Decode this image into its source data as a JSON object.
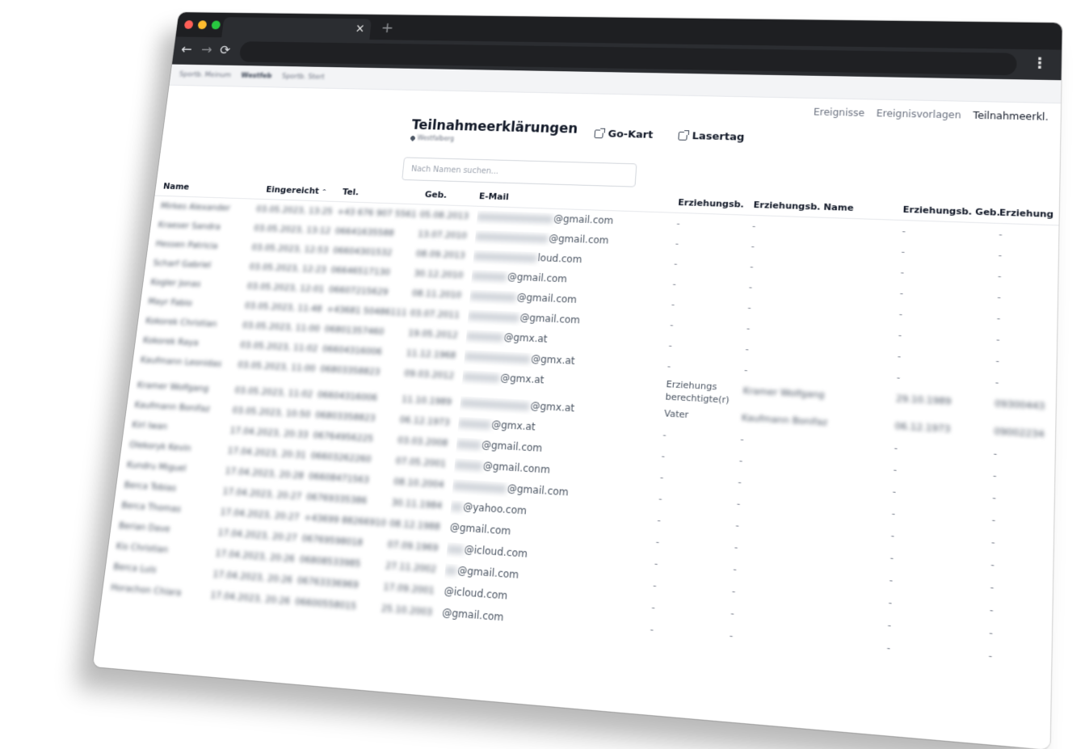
{
  "browser": {
    "tab_close": "×",
    "new_tab": "+",
    "back": "←",
    "forward": "→",
    "reload": "⟳",
    "menu": "⋮",
    "bookmarks": [
      "Sportb. Meinum",
      "Westfeb",
      "Sportb. Stert"
    ]
  },
  "nav": {
    "items": [
      "Ereignisse",
      "Ereignisvorlagen",
      "Teilnahmeerkl."
    ],
    "active": "Teilnahmeerkl."
  },
  "header": {
    "title": "Teilnahmeerklärungen",
    "location": "Westfalberg"
  },
  "events": [
    "Go-Kart",
    "Lasertag"
  ],
  "search": {
    "placeholder": "Nach Namen suchen..."
  },
  "table": {
    "headers": {
      "name": "Name",
      "submitted": "Eingereicht",
      "sort_indicator": "^",
      "phone": "Tel.",
      "birth": "Geb.",
      "email": "E-Mail",
      "guardian": "Erziehungsb.",
      "guardian_name": "Erziehungsb. Name",
      "guardian_birth": "Erziehungsb. Geb.",
      "guardian_tel": "Erziehung"
    },
    "rows": [
      {
        "name": "Mirkes Alexander",
        "submitted": "03.05.2023, 13:25",
        "phone": "+43 676 907 5561",
        "birth": "05.08.2013",
        "email_domain": "@gmail.com",
        "guardian": "-",
        "guardian_name": "-",
        "guardian_birth": "-",
        "guardian_tel": "-"
      },
      {
        "name": "Kraeser Sandra",
        "submitted": "03.05.2023, 13:12",
        "phone": "06641635588",
        "birth": "13.07.2010",
        "email_domain": "@gmail.com",
        "guardian": "-",
        "guardian_name": "-",
        "guardian_birth": "-",
        "guardian_tel": "-"
      },
      {
        "name": "Hessen Patricia",
        "submitted": "03.05.2023, 12:53",
        "phone": "06604301532",
        "birth": "08.09.2013",
        "email_domain": "loud.com",
        "guardian": "-",
        "guardian_name": "-",
        "guardian_birth": "-",
        "guardian_tel": "-"
      },
      {
        "name": "Scharf Gabriel",
        "submitted": "03.05.2023, 12:23",
        "phone": "06646517130",
        "birth": "30.12.2010",
        "email_domain": "@gmail.com",
        "guardian": "-",
        "guardian_name": "-",
        "guardian_birth": "-",
        "guardian_tel": "-"
      },
      {
        "name": "Kogler Jonas",
        "submitted": "03.05.2023, 12:01",
        "phone": "06607215629",
        "birth": "08.11.2010",
        "email_domain": "@gmail.com",
        "guardian": "-",
        "guardian_name": "-",
        "guardian_birth": "-",
        "guardian_tel": "-"
      },
      {
        "name": "Mayr Fabio",
        "submitted": "03.05.2023, 11:48",
        "phone": "+43681 50486111",
        "birth": "03.07.2011",
        "email_domain": "@gmail.com",
        "guardian": "-",
        "guardian_name": "-",
        "guardian_birth": "-",
        "guardian_tel": "-"
      },
      {
        "name": "Kokorek Christian",
        "submitted": "03.05.2023, 11:00",
        "phone": "06801357460",
        "birth": "19.05.2012",
        "email_domain": "@gmx.at",
        "guardian": "-",
        "guardian_name": "-",
        "guardian_birth": "-",
        "guardian_tel": "-"
      },
      {
        "name": "Kokorek Raya",
        "submitted": "03.05.2023, 11:02",
        "phone": "06604316006",
        "birth": "11.12.1968",
        "email_domain": "@gmx.at",
        "guardian": "-",
        "guardian_name": "-",
        "guardian_birth": "-",
        "guardian_tel": "-"
      },
      {
        "name": "Kaufmann Leonidas",
        "submitted": "03.05.2023, 11:00",
        "phone": "06803358823",
        "birth": "09.03.2012",
        "email_domain": "@gmx.at",
        "guardian": "Erziehungs berechtigte(r)",
        "guardian_name": "Kramer Wolfgang",
        "guardian_birth": "29.10.1989",
        "guardian_tel": "09300443"
      },
      {
        "name": "Kramer Wolfgang",
        "submitted": "03.05.2023, 11:02",
        "phone": "06604316006",
        "birth": "11.10.1989",
        "email_domain": "@gmx.at",
        "guardian": "Vater",
        "guardian_name": "Kaufmann Bonifaz",
        "guardian_birth": "06.12.1973",
        "guardian_tel": "09002234"
      },
      {
        "name": "Kaufmann Bonifaz",
        "submitted": "03.05.2023, 10:50",
        "phone": "06803358823",
        "birth": "06.12.1973",
        "email_domain": "@gmx.at",
        "guardian": "-",
        "guardian_name": "-",
        "guardian_birth": "-",
        "guardian_tel": "-"
      },
      {
        "name": "Kirl Iwan",
        "submitted": "17.04.2023, 20:33",
        "phone": "06764956225",
        "birth": "03.03.2008",
        "email_domain": "@gmail.com",
        "guardian": "-",
        "guardian_name": "-",
        "guardian_birth": "-",
        "guardian_tel": "-"
      },
      {
        "name": "Olekoryk Kevin",
        "submitted": "17.04.2023, 20:31",
        "phone": "06603262260",
        "birth": "07.05.2001",
        "email_domain": "@gmail.conm",
        "guardian": "-",
        "guardian_name": "-",
        "guardian_birth": "-",
        "guardian_tel": "-"
      },
      {
        "name": "Kundru Miguel",
        "submitted": "17.04.2023, 20:28",
        "phone": "06608471563",
        "birth": "08.10.2004",
        "email_domain": "@gmail.com",
        "guardian": "-",
        "guardian_name": "-",
        "guardian_birth": "-",
        "guardian_tel": "-"
      },
      {
        "name": "Berca Tobias",
        "submitted": "17.04.2023, 20:27",
        "phone": "06769335386",
        "birth": "30.11.1984",
        "email_domain": "@yahoo.com",
        "guardian": "-",
        "guardian_name": "-",
        "guardian_birth": "-",
        "guardian_tel": "-"
      },
      {
        "name": "Berca Thomas",
        "submitted": "17.04.2023, 20:27",
        "phone": "+43699 88266910",
        "birth": "08.12.1988",
        "email_domain": "@gmail.com",
        "guardian": "-",
        "guardian_name": "-",
        "guardian_birth": "-",
        "guardian_tel": "-"
      },
      {
        "name": "Berian Dave",
        "submitted": "17.04.2023, 20:27",
        "phone": "06769598018",
        "birth": "07.09.1969",
        "email_domain": "@icloud.com",
        "guardian": "-",
        "guardian_name": "-",
        "guardian_birth": "-",
        "guardian_tel": "-"
      },
      {
        "name": "Kis Christian",
        "submitted": "17.04.2023, 20:26",
        "phone": "06808533985",
        "birth": "27.11.2002",
        "email_domain": "@gmail.com",
        "guardian": "-",
        "guardian_name": "-",
        "guardian_birth": "-",
        "guardian_tel": "-"
      },
      {
        "name": "Berca Luis",
        "submitted": "17.04.2023, 20:26",
        "phone": "06763336969",
        "birth": "17.09.2001",
        "email_domain": "@icloud.com",
        "guardian": "-",
        "guardian_name": "-",
        "guardian_birth": "-",
        "guardian_tel": "-"
      },
      {
        "name": "Horachon Chiara",
        "submitted": "17.04.2023, 20:26",
        "phone": "06600558015",
        "birth": "25.10.2003",
        "email_domain": "@gmail.com",
        "guardian": "-",
        "guardian_name": "-",
        "guardian_birth": "-",
        "guardian_tel": "-"
      }
    ]
  }
}
